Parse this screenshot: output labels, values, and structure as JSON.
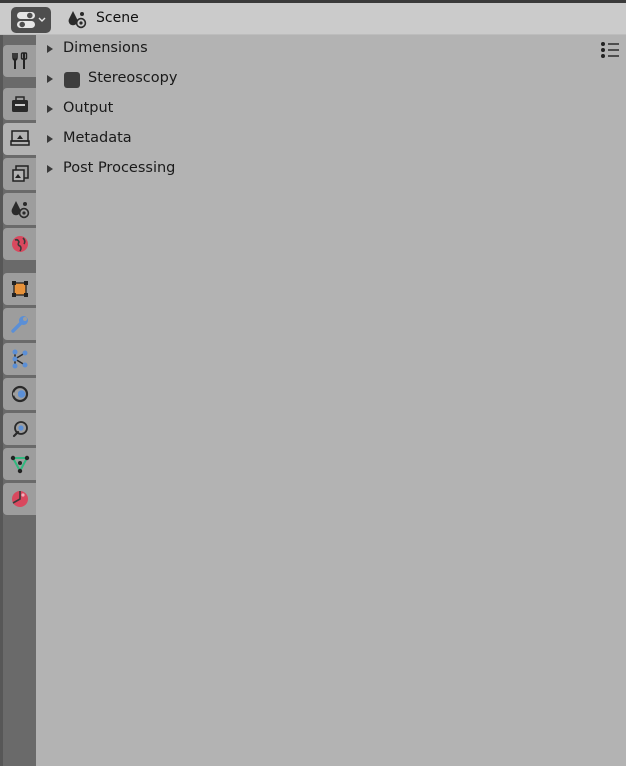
{
  "header": {
    "context_label": "Scene",
    "editor_icon": "properties-editor-icon",
    "context_icon": "scene-icon"
  },
  "tabs": [
    {
      "name": "tool",
      "icon": "tool-icon"
    },
    {
      "name": "render",
      "icon": "render-icon"
    },
    {
      "name": "output",
      "icon": "output-icon",
      "active": true
    },
    {
      "name": "view-layer",
      "icon": "view-layer-icon"
    },
    {
      "name": "scene",
      "icon": "scene-icon"
    },
    {
      "name": "world",
      "icon": "world-icon"
    },
    {
      "name": "object",
      "icon": "object-icon"
    },
    {
      "name": "modifier",
      "icon": "modifier-icon"
    },
    {
      "name": "particles",
      "icon": "particles-icon"
    },
    {
      "name": "physics",
      "icon": "physics-icon"
    },
    {
      "name": "constraints",
      "icon": "constraints-icon"
    },
    {
      "name": "data",
      "icon": "data-icon"
    },
    {
      "name": "material",
      "icon": "material-icon"
    }
  ],
  "panels": [
    {
      "label": "Dimensions",
      "collapsed": true
    },
    {
      "label": "Stereoscopy",
      "collapsed": true,
      "checkbox": false
    },
    {
      "label": "Output",
      "collapsed": true
    },
    {
      "label": "Metadata",
      "collapsed": true
    },
    {
      "label": "Post Processing",
      "collapsed": true
    }
  ],
  "colors": {
    "background": "#b3b3b3",
    "header": "#cbcbcb",
    "tab_bar": "#6a6a6a",
    "tab": "#9d9d9d",
    "tab_active": "#b3b3b3",
    "world_accent": "#d9485e",
    "object_accent": "#e8923a",
    "blue_accent": "#5b8fd6",
    "data_accent": "#2fb87e"
  }
}
